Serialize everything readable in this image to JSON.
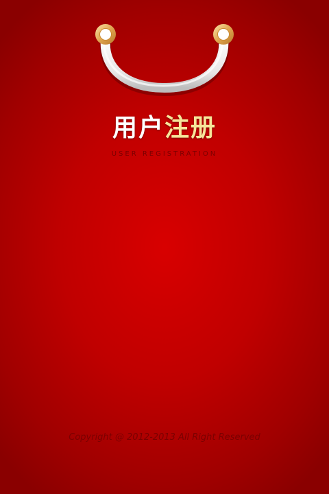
{
  "title": {
    "part1": "用户",
    "part2": "注册"
  },
  "subtitle": "USER REGISTRATION",
  "footer": {
    "copyright": "Copyright @ 2012-2013 All Right Reserved"
  },
  "colors": {
    "background": "#c00000",
    "title_white": "#ffffff",
    "title_gold": "#f6e59a",
    "muted_text": "#7a0000"
  },
  "icons": {
    "handle": "bag-handle-icon"
  }
}
